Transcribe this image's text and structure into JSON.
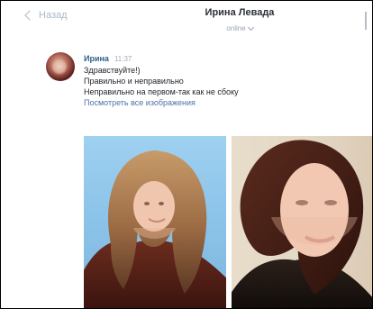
{
  "header": {
    "back_label": "Назад",
    "title": "Ирина Левада",
    "status": "online"
  },
  "message": {
    "author": "Ирина",
    "time": "11:37",
    "lines": [
      "Здравствуйте!)",
      "Правильно и неправильно",
      "Неправильно на первом-так как не сбоку"
    ],
    "link": "Посмотреть все изображения"
  },
  "colors": {
    "accent_link": "#4a73a6",
    "author": "#2f5d8a",
    "muted": "#a9b8c9"
  },
  "icons": {
    "back": "chevron-left-icon",
    "status_dropdown": "chevron-down-icon",
    "more": "more-icon"
  }
}
